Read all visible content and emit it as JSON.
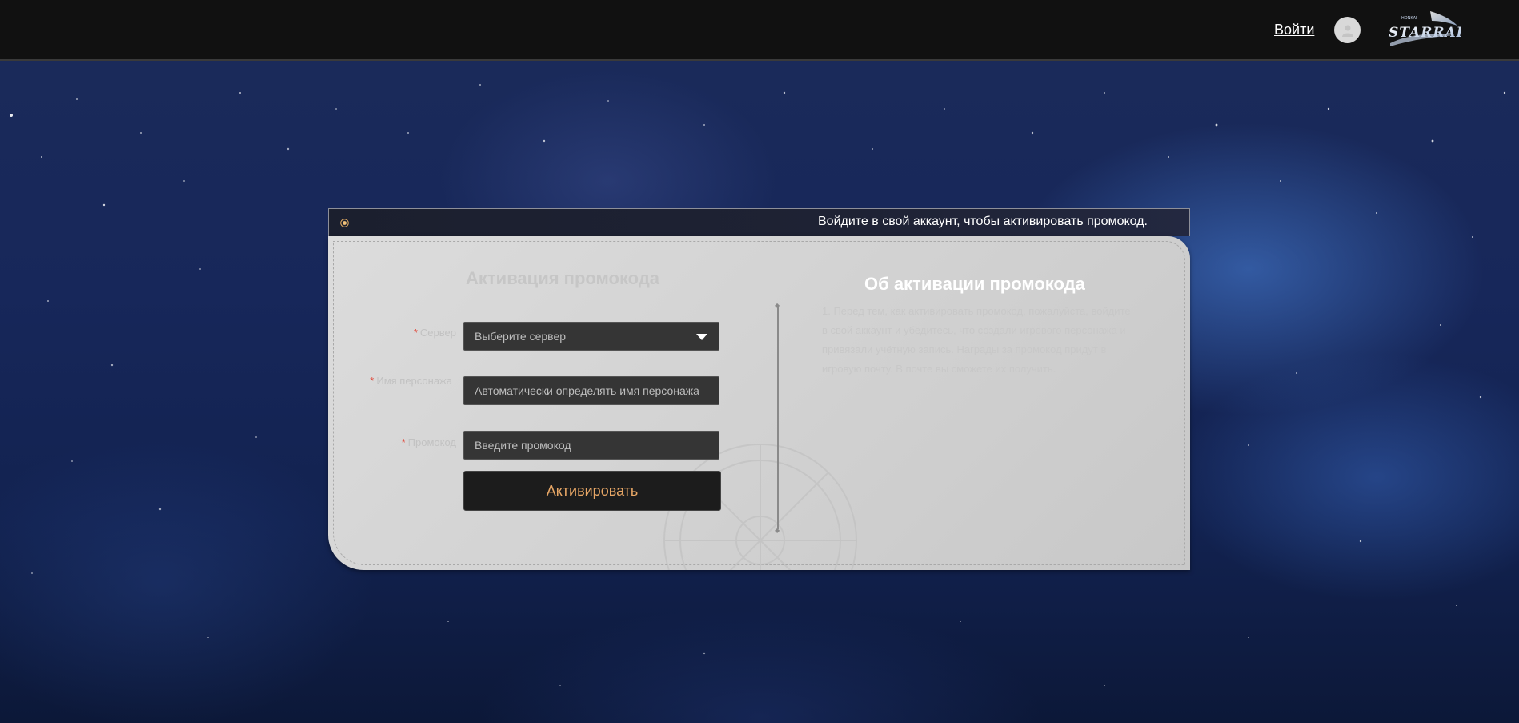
{
  "header": {
    "login_label": "Войти",
    "avatar_icon": "user-avatar-icon",
    "logo_icon": "honkai-star-rail-logo"
  },
  "panel": {
    "notice": "Войдите в свой аккаунт, чтобы активировать промокод.",
    "form": {
      "title": "Активация промокода",
      "server_label": "Сервер",
      "server_placeholder": "Выберите сервер",
      "character_label": "Имя персонажа",
      "character_placeholder": "Автоматически определять имя персонажа",
      "code_label": "Промокод",
      "code_placeholder": "Введите промокод",
      "submit_label": "Активировать"
    },
    "about": {
      "title": "Об активации промокода",
      "text": "1. Перед тем, как активировать промокод, пожалуйста, войдите в свой аккаунт и убедитесь, что создали игрового персонажа и привязали учётную запись. Награды за промокод придут в игровую почту. В почте вы сможете их получить."
    }
  },
  "colors": {
    "header_bg": "#111111",
    "accent_orange": "#e8a766",
    "required_red": "#e14a3c",
    "panel_bg": "#d6d6d6"
  }
}
